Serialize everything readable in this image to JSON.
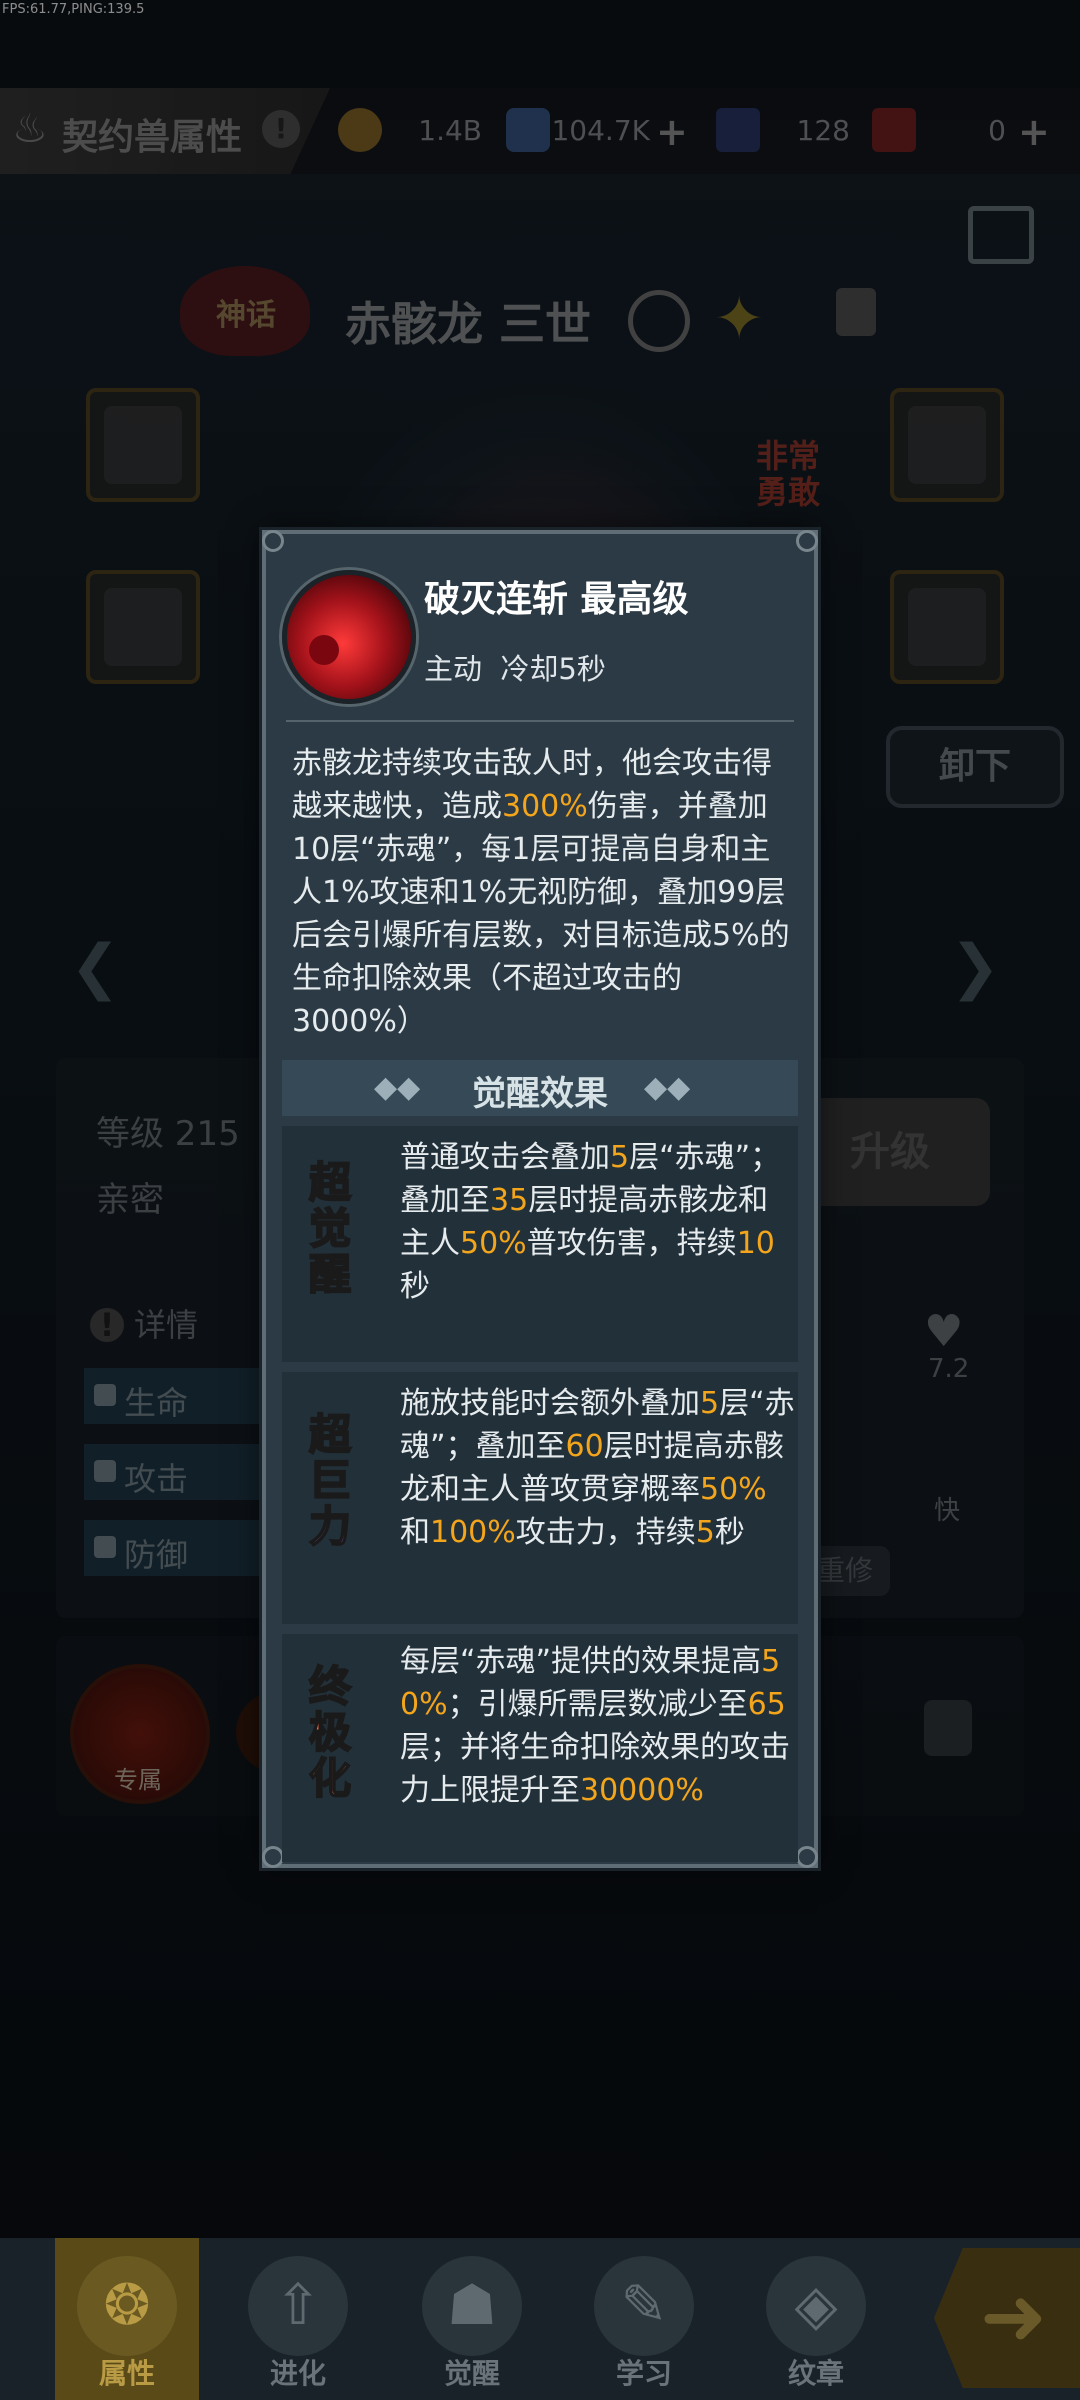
{
  "debug": {
    "fps_text": "FPS:61.77,PING:139.5"
  },
  "topbar": {
    "title": "契约兽属性",
    "info_glyph": "!",
    "resources": [
      {
        "icon": "gold-coin-icon",
        "value": "1.4B"
      },
      {
        "icon": "blue-crystal-icon",
        "value": "104.7K",
        "plus": "+"
      },
      {
        "icon": "card-ticket-icon",
        "value": "128"
      },
      {
        "icon": "red-ticket-icon",
        "value": "0",
        "plus": "+"
      }
    ]
  },
  "pet": {
    "badge": "神话",
    "name": "赤骸龙 三世",
    "trait": "非常\n勇敢",
    "unload_label": "卸下"
  },
  "stats": {
    "level": "等级 215",
    "intimacy": "亲密",
    "upgrade_label": "升级",
    "detail_label": "详情",
    "detail_glyph": "!",
    "rows": [
      "生命",
      "攻击",
      "防御"
    ],
    "heart_value": "7.2",
    "speed_label": "快",
    "repair_label": "重修",
    "exclusive_label": "专属"
  },
  "nav": {
    "items": [
      {
        "label": "属性",
        "icon": "paw-icon",
        "active": true
      },
      {
        "label": "进化",
        "icon": "arrow-up-icon"
      },
      {
        "label": "觉醒",
        "icon": "fox-mask-icon"
      },
      {
        "label": "学习",
        "icon": "feather-icon"
      },
      {
        "label": "纹章",
        "icon": "crest-icon"
      }
    ],
    "go_glyph": "➜"
  },
  "skill": {
    "title": "破灭连斩 最高级",
    "subtitle": "主动  冷却5秒",
    "description_parts": [
      "赤骸龙持续攻击敌人时，他会攻击得越来越快，造成",
      "300%",
      "伤害，并叠加10层“赤魂”，每1层可提高自身和主人1%攻速和1%无视防御，叠加99层后会引爆所有层数，对目标造成5%的生命扣除效果（不超过攻击的3000%）"
    ],
    "awakening_header": "觉醒效果",
    "effects": [
      {
        "tag": "超觉醒",
        "parts": [
          "普通攻击会叠加",
          "5",
          "层“赤魂”；叠加至",
          "35",
          "层时提高赤骸龙和主人",
          "50%",
          "普攻伤害，持续",
          "10",
          "秒"
        ]
      },
      {
        "tag": "超巨力",
        "parts": [
          "施放技能时会额外叠加",
          "5",
          "层“赤魂”；叠加至",
          "60",
          "层时提高赤骸龙和主人普攻贯穿概率",
          "50%",
          "和",
          "100%",
          "攻击力，持续",
          "5",
          "秒"
        ]
      },
      {
        "tag": "终极化",
        "parts": [
          "每层“赤魂”提供的效果提高",
          "50%",
          "；引爆所需层数减少至",
          "65",
          "层；并将生命扣除效果的攻击力上限提升至",
          "30000%",
          ""
        ]
      }
    ]
  }
}
